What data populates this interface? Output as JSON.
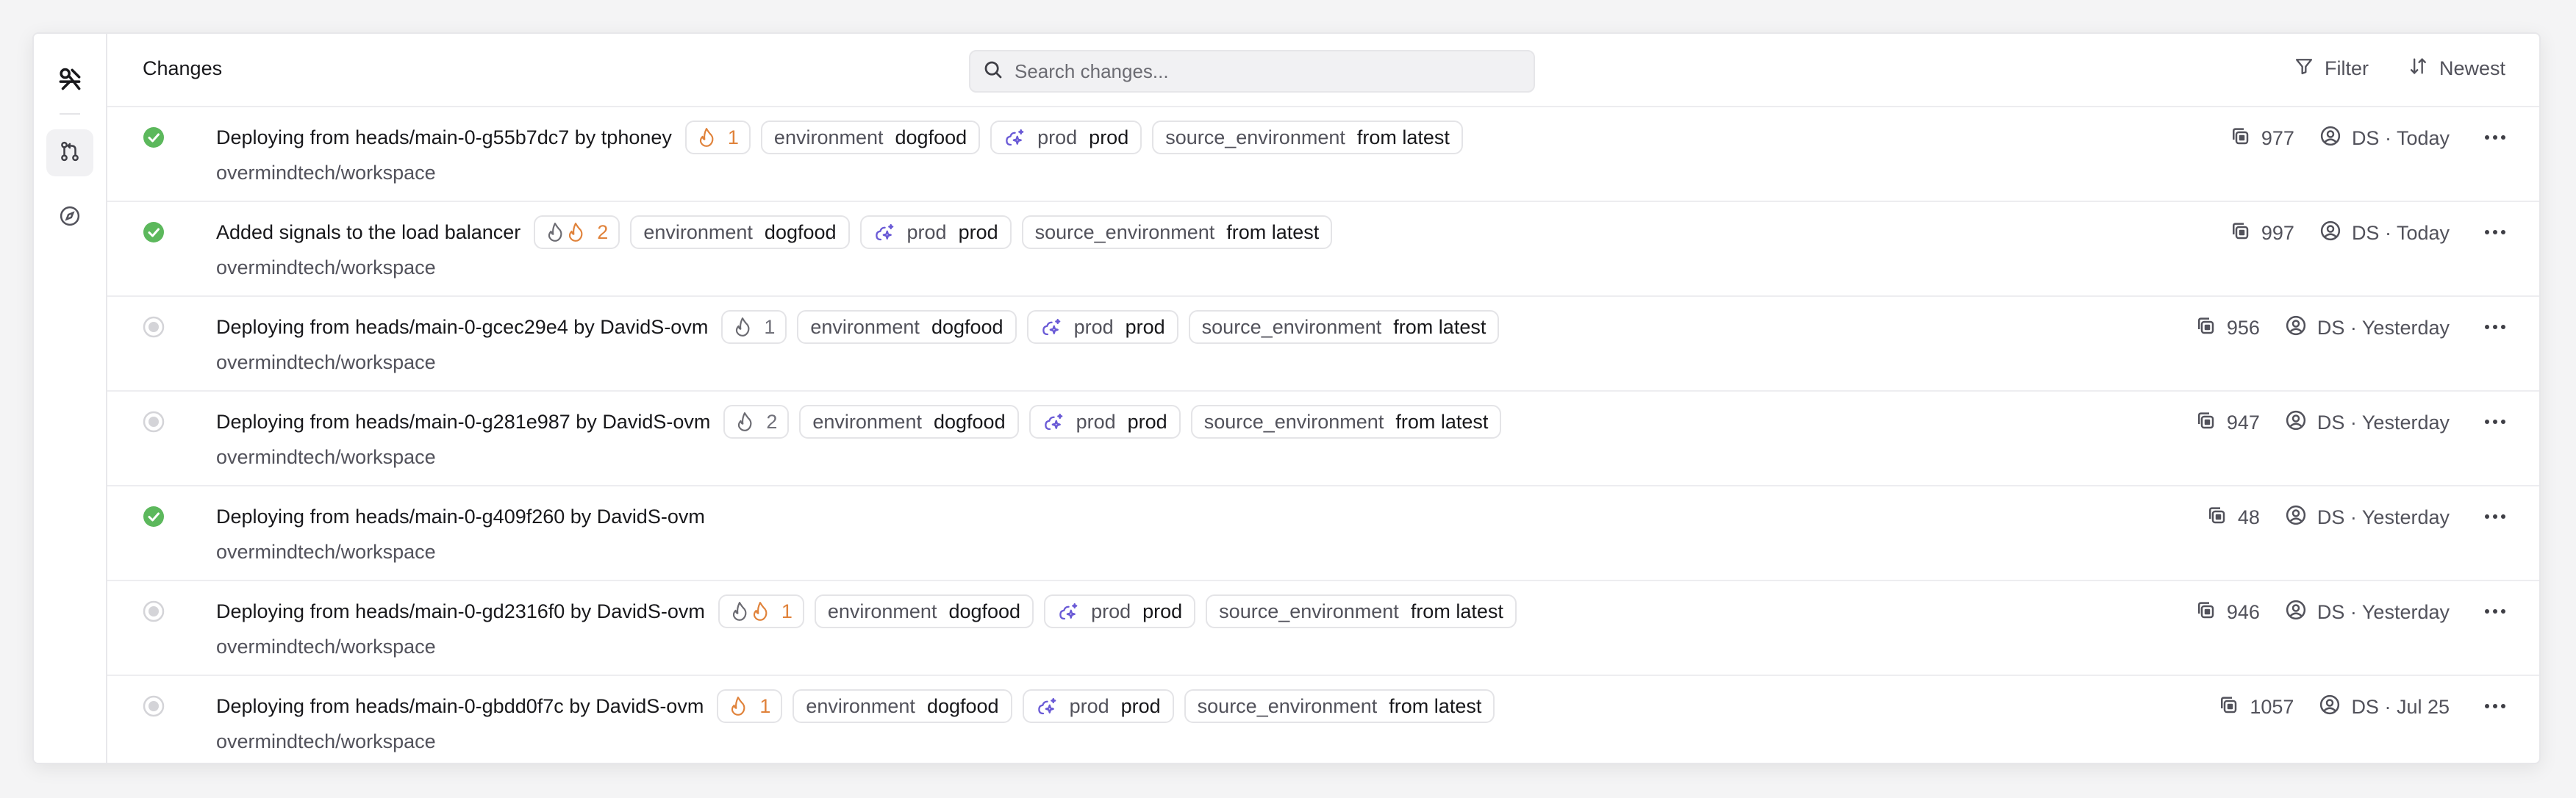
{
  "header": {
    "title": "Changes",
    "search_placeholder": "Search changes...",
    "filter_label": "Filter",
    "sort_label": "Newest"
  },
  "tag_keys": {
    "environment": "environment",
    "prod": "prod",
    "source_environment": "source_environment"
  },
  "rows": [
    {
      "status": "success",
      "title": "Deploying from heads/main-0-g55b7dc7 by tphoney",
      "repo": "overmindtech/workspace",
      "risk_icons": [
        "flame-orange"
      ],
      "risk_count": "1",
      "risk_color": "orange",
      "tags": {
        "environment": "dogfood",
        "prod": "prod",
        "source_environment": "from latest"
      },
      "items": "977",
      "author": "DS · Today"
    },
    {
      "status": "success",
      "title": "Added signals to the load balancer",
      "repo": "overmindtech/workspace",
      "risk_icons": [
        "flame-gray",
        "flame-orange"
      ],
      "risk_count": "2",
      "risk_color": "orange",
      "tags": {
        "environment": "dogfood",
        "prod": "prod",
        "source_environment": "from latest"
      },
      "items": "997",
      "author": "DS · Today"
    },
    {
      "status": "pending",
      "title": "Deploying from heads/main-0-gcec29e4 by DavidS-ovm",
      "repo": "overmindtech/workspace",
      "risk_icons": [
        "flame-gray"
      ],
      "risk_count": "1",
      "risk_color": "gray",
      "tags": {
        "environment": "dogfood",
        "prod": "prod",
        "source_environment": "from latest"
      },
      "items": "956",
      "author": "DS · Yesterday"
    },
    {
      "status": "pending",
      "title": "Deploying from heads/main-0-g281e987 by DavidS-ovm",
      "repo": "overmindtech/workspace",
      "risk_icons": [
        "flame-gray"
      ],
      "risk_count": "2",
      "risk_color": "gray",
      "tags": {
        "environment": "dogfood",
        "prod": "prod",
        "source_environment": "from latest"
      },
      "items": "947",
      "author": "DS · Yesterday"
    },
    {
      "status": "success",
      "title": "Deploying from heads/main-0-g409f260 by DavidS-ovm",
      "repo": "overmindtech/workspace",
      "risk_icons": [],
      "risk_count": "",
      "risk_color": "gray",
      "tags": null,
      "items": "48",
      "author": "DS · Yesterday"
    },
    {
      "status": "pending",
      "title": "Deploying from heads/main-0-gd2316f0 by DavidS-ovm",
      "repo": "overmindtech/workspace",
      "risk_icons": [
        "flame-gray",
        "flame-orange"
      ],
      "risk_count": "1",
      "risk_color": "orange",
      "tags": {
        "environment": "dogfood",
        "prod": "prod",
        "source_environment": "from latest"
      },
      "items": "946",
      "author": "DS · Yesterday"
    },
    {
      "status": "pending",
      "title": "Deploying from heads/main-0-gbdd0f7c by DavidS-ovm",
      "repo": "overmindtech/workspace",
      "risk_icons": [
        "flame-orange"
      ],
      "risk_count": "1",
      "risk_color": "orange",
      "tags": {
        "environment": "dogfood",
        "prod": "prod",
        "source_environment": "from latest"
      },
      "items": "1057",
      "author": "DS · Jul 25"
    }
  ],
  "colors": {
    "success": "#5cb85c",
    "pending": "#d4d4d8",
    "flame_orange": "#e0823a",
    "flame_gray": "#6b6b72",
    "prod_icon": "#6a5ad6"
  },
  "icons": {
    "rail": [
      "logo-icon",
      "git-pull-request-icon",
      "compass-icon"
    ],
    "header": [
      "search-icon",
      "filter-icon",
      "sort-icon"
    ],
    "row": [
      "status-check-icon",
      "flame-icon",
      "sparkle-cloud-icon",
      "stack-icon",
      "user-circle-icon",
      "more-horizontal-icon"
    ]
  }
}
